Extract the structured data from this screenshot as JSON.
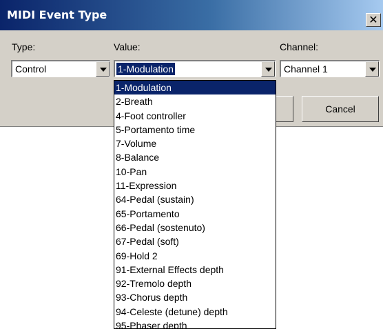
{
  "window": {
    "title": "MIDI Event Type",
    "close_glyph": "✕"
  },
  "labels": {
    "type": "Type:",
    "value": "Value:",
    "channel": "Channel:"
  },
  "type_select": {
    "selected": "Control"
  },
  "value_select": {
    "selected": "1-Modulation"
  },
  "channel_select": {
    "selected": "Channel 1"
  },
  "buttons": {
    "cancel": "Cancel",
    "ok": ""
  },
  "dropdown": {
    "items": [
      "1-Modulation",
      "2-Breath",
      "4-Foot controller",
      "5-Portamento time",
      "7-Volume",
      "8-Balance",
      "10-Pan",
      "11-Expression",
      "64-Pedal (sustain)",
      "65-Portamento",
      "66-Pedal (sostenuto)",
      "67-Pedal (soft)",
      "69-Hold 2",
      "91-External Effects depth",
      "92-Tremolo depth",
      "93-Chorus depth",
      "94-Celeste (detune) depth",
      "95-Phaser depth"
    ],
    "highlighted_index": 0
  },
  "colors": {
    "title_start": "#0a246a",
    "title_end": "#a6caf0",
    "selection": "#0a246a",
    "face": "#d4d0c8"
  }
}
